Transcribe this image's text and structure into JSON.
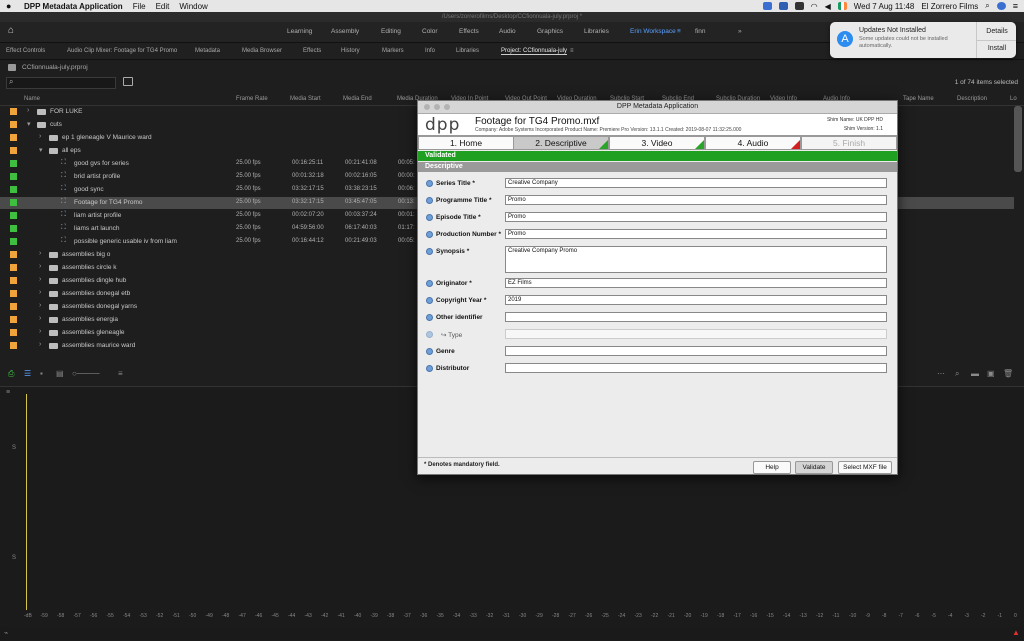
{
  "menubar": {
    "apple": "",
    "app_name": "DPP Metadata Application",
    "menus": [
      "File",
      "Edit",
      "Window"
    ],
    "clock": "Wed 7 Aug  11:48",
    "user": "El Zorrero Films"
  },
  "window_path": "/Users/zorrerofilms/Desktop/CCfionnuala-july.prproj *",
  "workspaces": [
    "Learning",
    "Assembly",
    "Editing",
    "Color",
    "Effects",
    "Audio",
    "Graphics",
    "Libraries",
    "Erin Workspace",
    "finn"
  ],
  "panel_tabs": [
    "Effect Controls",
    "Audio Clip Mixer: Footage for TG4 Promo",
    "Metadata",
    "Media Browser",
    "Effects",
    "History",
    "Markers",
    "Info",
    "Libraries",
    "Project: CCfionnuala-july"
  ],
  "project": {
    "file": "CCfionnuala-july.prproj",
    "items_count": "1 of 74 items selected"
  },
  "columns": [
    "Name",
    "Frame Rate",
    "Media Start",
    "Media End",
    "Media Duration",
    "Video In Point",
    "Video Out Point",
    "Video Duration",
    "Subclip Start",
    "Subclip End",
    "Subclip Duration",
    "Video Info",
    "Audio Info",
    "Tape Name",
    "Description",
    "Lo"
  ],
  "rows": [
    {
      "name": "FOR LUKE",
      "type": "bin",
      "indent": 0,
      "color": "#f0a33a",
      "fr": "",
      "ms": "",
      "me": "",
      "md": ""
    },
    {
      "name": "cuts",
      "type": "bin",
      "indent": 0,
      "color": "#f0a33a",
      "fr": "",
      "ms": "",
      "me": "",
      "md": ""
    },
    {
      "name": "ep 1 gleneagle V Maurice ward",
      "type": "bin",
      "indent": 1,
      "color": "#f0a33a",
      "fr": "",
      "ms": "",
      "me": "",
      "md": ""
    },
    {
      "name": "all eps",
      "type": "bin",
      "indent": 1,
      "color": "#f0a33a",
      "fr": "",
      "ms": "",
      "me": "",
      "md": ""
    },
    {
      "name": "good gvs for series",
      "type": "seq",
      "indent": 2,
      "color": "#3fbf3f",
      "fr": "25.00 fps",
      "ms": "00:16:25:11",
      "me": "00:21:41:08",
      "md": "00:05:"
    },
    {
      "name": "brid artist profile",
      "type": "seq",
      "indent": 2,
      "color": "#3fbf3f",
      "fr": "25.00 fps",
      "ms": "00:01:32:18",
      "me": "00:02:16:05",
      "md": "00:00:"
    },
    {
      "name": "good sync",
      "type": "seq",
      "indent": 2,
      "color": "#3fbf3f",
      "fr": "25.00 fps",
      "ms": "03:32:17:15",
      "me": "03:38:23:15",
      "md": "00:06:"
    },
    {
      "name": "Footage for TG4 Promo",
      "type": "seq",
      "indent": 2,
      "color": "#3fbf3f",
      "fr": "25.00 fps",
      "ms": "03:32:17:15",
      "me": "03:45:47:05",
      "md": "00:13:",
      "selected": true
    },
    {
      "name": "liam artist profile",
      "type": "seq",
      "indent": 2,
      "color": "#3fbf3f",
      "fr": "25.00 fps",
      "ms": "00:02:07:20",
      "me": "00:03:37:24",
      "md": "00:01:"
    },
    {
      "name": "liams art launch",
      "type": "seq",
      "indent": 2,
      "color": "#3fbf3f",
      "fr": "25.00 fps",
      "ms": "04:59:56:00",
      "me": "06:17:40:03",
      "md": "01:17:"
    },
    {
      "name": "possible generic usable iv from liam",
      "type": "seq",
      "indent": 2,
      "color": "#3fbf3f",
      "fr": "25.00 fps",
      "ms": "00:16:44:12",
      "me": "00:21:49:03",
      "md": "00:05:"
    },
    {
      "name": "assemblies big o",
      "type": "bin",
      "indent": 1,
      "color": "#f0a33a",
      "fr": "",
      "ms": "",
      "me": "",
      "md": ""
    },
    {
      "name": "assemblies circle k",
      "type": "bin",
      "indent": 1,
      "color": "#f0a33a",
      "fr": "",
      "ms": "",
      "me": "",
      "md": ""
    },
    {
      "name": "assemblies dingle hub",
      "type": "bin",
      "indent": 1,
      "color": "#f0a33a",
      "fr": "",
      "ms": "",
      "me": "",
      "md": ""
    },
    {
      "name": "assemblies donegal etb",
      "type": "bin",
      "indent": 1,
      "color": "#f0a33a",
      "fr": "",
      "ms": "",
      "me": "",
      "md": ""
    },
    {
      "name": "assemblies donegal yarns",
      "type": "bin",
      "indent": 1,
      "color": "#f0a33a",
      "fr": "",
      "ms": "",
      "me": "",
      "md": ""
    },
    {
      "name": "assemblies energia",
      "type": "bin",
      "indent": 1,
      "color": "#f0a33a",
      "fr": "",
      "ms": "",
      "me": "",
      "md": ""
    },
    {
      "name": "assemblies gleneagle",
      "type": "bin",
      "indent": 1,
      "color": "#f0a33a",
      "fr": "",
      "ms": "",
      "me": "",
      "md": ""
    },
    {
      "name": "assemblies maurice ward",
      "type": "bin",
      "indent": 1,
      "color": "#f0a33a",
      "fr": "",
      "ms": "",
      "me": "",
      "md": ""
    }
  ],
  "timeline": {
    "ruler": [
      "-dB",
      "-59",
      "-58",
      "-57",
      "-56",
      "-55",
      "-54",
      "-53",
      "-52",
      "-51",
      "-50",
      "-49",
      "-48",
      "-47",
      "-46",
      "-45",
      "-44",
      "-43",
      "-42",
      "-41",
      "-40",
      "-39",
      "-38",
      "-37",
      "-36",
      "-35",
      "-34",
      "-33",
      "-32",
      "-31",
      "-30",
      "-29",
      "-28",
      "-27",
      "-26",
      "-25",
      "-24",
      "-23",
      "-22",
      "-21",
      "-20",
      "-19",
      "-18",
      "-17",
      "-16",
      "-15",
      "-14",
      "-13",
      "-12",
      "-11",
      "-10",
      "-9",
      "-8",
      "-7",
      "-6",
      "-5",
      "-4",
      "-3",
      "-2",
      "-1",
      "0"
    ],
    "s1": "S",
    "s2": "S"
  },
  "notification": {
    "title": "Updates Not Installed",
    "body": "Some updates could not be installed automatically.",
    "details": "Details",
    "install": "Install"
  },
  "dialog": {
    "window_title": "DPP Metadata Application",
    "logo": "dpp",
    "file_name": "Footage for TG4 Promo.mxf",
    "meta": "Company: Adobe Systems Incorporated  Product Name: Premiere Pro  Version: 13.1.1  Created: 2019-08-07 11:32:25.000",
    "shim_name": "Shim Name: UK DPP HD",
    "shim_version": "Shim Version: 1.1",
    "tabs": [
      {
        "label": "1. Home",
        "state": "normal",
        "flag": ""
      },
      {
        "label": "2. Descriptive",
        "state": "current",
        "flag": "g"
      },
      {
        "label": "3. Video",
        "state": "normal",
        "flag": "g"
      },
      {
        "label": "4. Audio",
        "state": "normal",
        "flag": "r"
      },
      {
        "label": "5. Finish",
        "state": "disabled",
        "flag": ""
      }
    ],
    "status": "Validated",
    "section": "Descriptive",
    "fields": {
      "series_title": {
        "label": "Series Title *",
        "value": "Creative Company"
      },
      "programme_title": {
        "label": "Programme Title *",
        "value": "Promo"
      },
      "episode_title": {
        "label": "Episode Title *",
        "value": "Promo"
      },
      "production_number": {
        "label": "Production Number *",
        "value": "Promo"
      },
      "synopsis": {
        "label": "Synopsis *",
        "value": "Creative Company Promo"
      },
      "originator": {
        "label": "Originator *",
        "value": "EZ Films"
      },
      "copyright_year": {
        "label": "Copyright Year *",
        "value": "2019"
      },
      "other_identifier": {
        "label": "Other identifier",
        "value": ""
      },
      "type": {
        "label": "↪ Type",
        "value": ""
      },
      "genre": {
        "label": "Genre",
        "value": ""
      },
      "distributor": {
        "label": "Distributor",
        "value": ""
      }
    },
    "footer_note": "* Denotes mandatory field.",
    "buttons": {
      "help": "Help",
      "validate": "Validate",
      "select": "Select MXF file"
    }
  }
}
